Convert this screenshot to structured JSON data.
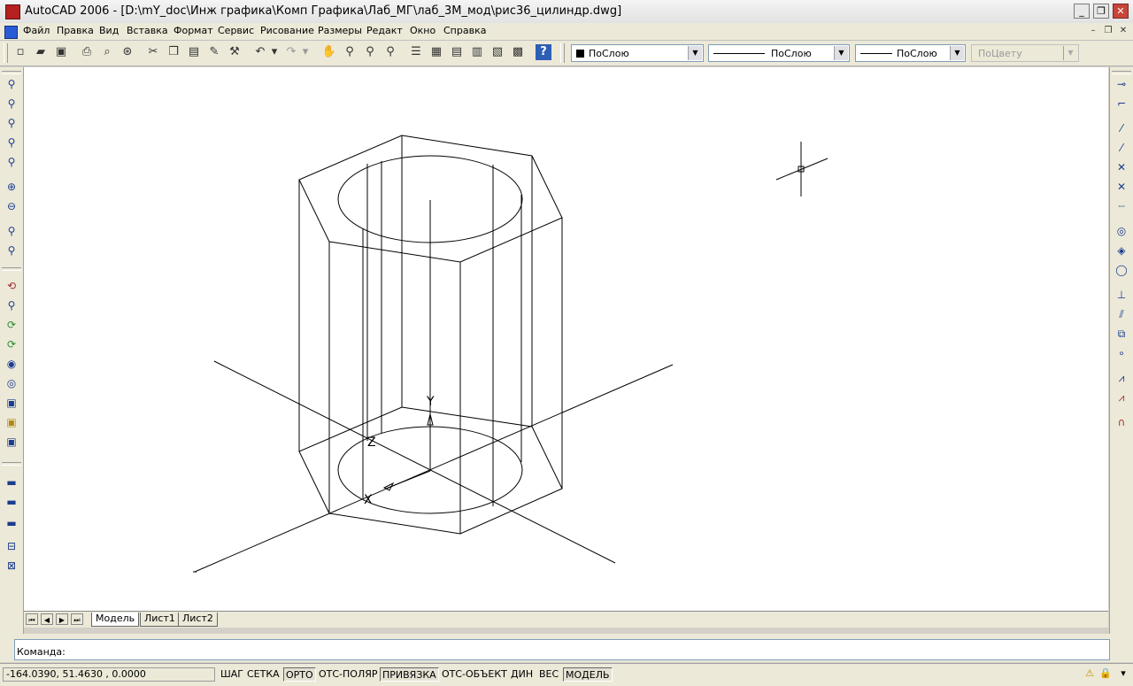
{
  "window": {
    "title": "AutoCAD 2006 - [D:\\mY_doc\\Инж графика\\Комп Графика\\Лаб_МГ\\лаб_3М_мод\\рис36_цилиндр.dwg]"
  },
  "menu": [
    "Файл",
    "Правка",
    "Вид",
    "Вставка",
    "Формат",
    "Сервис",
    "Рисование",
    "Размеры",
    "Редакт",
    "Окно",
    "Справка"
  ],
  "properties": {
    "color": "ПоСлою",
    "linetype": "ПоСлою",
    "lineweight": "ПоСлою",
    "plotstyle": "ПоЦвету"
  },
  "ucs": {
    "x_label": "X",
    "y_label": "Y",
    "z_label": "Z"
  },
  "tabs": [
    "Модель",
    "Лист1",
    "Лист2"
  ],
  "active_tab": "Модель",
  "command": {
    "prompt": "Команда:",
    "value": ""
  },
  "status": {
    "coords": "-164.0390, 51.4630  , 0.0000",
    "toggles": [
      {
        "label": "ШАГ",
        "on": false
      },
      {
        "label": "СЕТКА",
        "on": false
      },
      {
        "label": "ОРТО",
        "on": true
      },
      {
        "label": "ОТС-ПОЛЯР",
        "on": false
      },
      {
        "label": "ПРИВЯЗКА",
        "on": true
      },
      {
        "label": "ОТС-ОБЪЕКТ",
        "on": false
      },
      {
        "label": "ДИН",
        "on": false
      },
      {
        "label": "ВЕС",
        "on": false
      },
      {
        "label": "МОДЕЛЬ",
        "on": true
      }
    ]
  },
  "icons": {
    "standard_toolbar": [
      "new-icon",
      "open-icon",
      "save-icon",
      "print-icon",
      "preview-icon",
      "publish-icon",
      "cut-icon",
      "copy-icon",
      "paste-icon",
      "matchprop-icon",
      "blockeditor-icon",
      "undo-icon",
      "redo-icon",
      "pan-icon",
      "zoom-realtime-icon",
      "zoom-window-icon",
      "zoom-previous-icon",
      "properties-icon",
      "designcenter-icon",
      "toolpalettes-icon",
      "sheetset-icon",
      "markup-icon",
      "calculator-icon",
      "help-icon"
    ],
    "left_toolbar": [
      "zoom-window-icon",
      "zoom-dynamic-icon",
      "zoom-scale-icon",
      "zoom-center-icon",
      "zoom-object-icon",
      "zoom-in-icon",
      "zoom-out-icon",
      "zoom-all-icon",
      "zoom-extents-icon",
      "orbit-icon",
      "orbit-free-icon",
      "orbit-continuous-icon",
      "camera-icon",
      "walk-icon",
      "fly-icon",
      "view-icon",
      "named-view-icon",
      "ucs-icon",
      "ucs-world-icon",
      "ucs-previous-icon",
      "ucs-face-icon",
      "ucs-object-icon"
    ],
    "right_toolbar": [
      "snap-endpoint-icon",
      "snap-midpoint-icon",
      "snap-intersection-icon",
      "snap-apparent-icon",
      "snap-extension-icon",
      "snap-center-icon",
      "snap-quadrant-icon",
      "snap-tangent-icon",
      "snap-perpendicular-icon",
      "snap-parallel-icon",
      "snap-insert-icon",
      "snap-node-icon",
      "snap-nearest-icon",
      "snap-none-icon",
      "osnap-settings-icon"
    ]
  }
}
